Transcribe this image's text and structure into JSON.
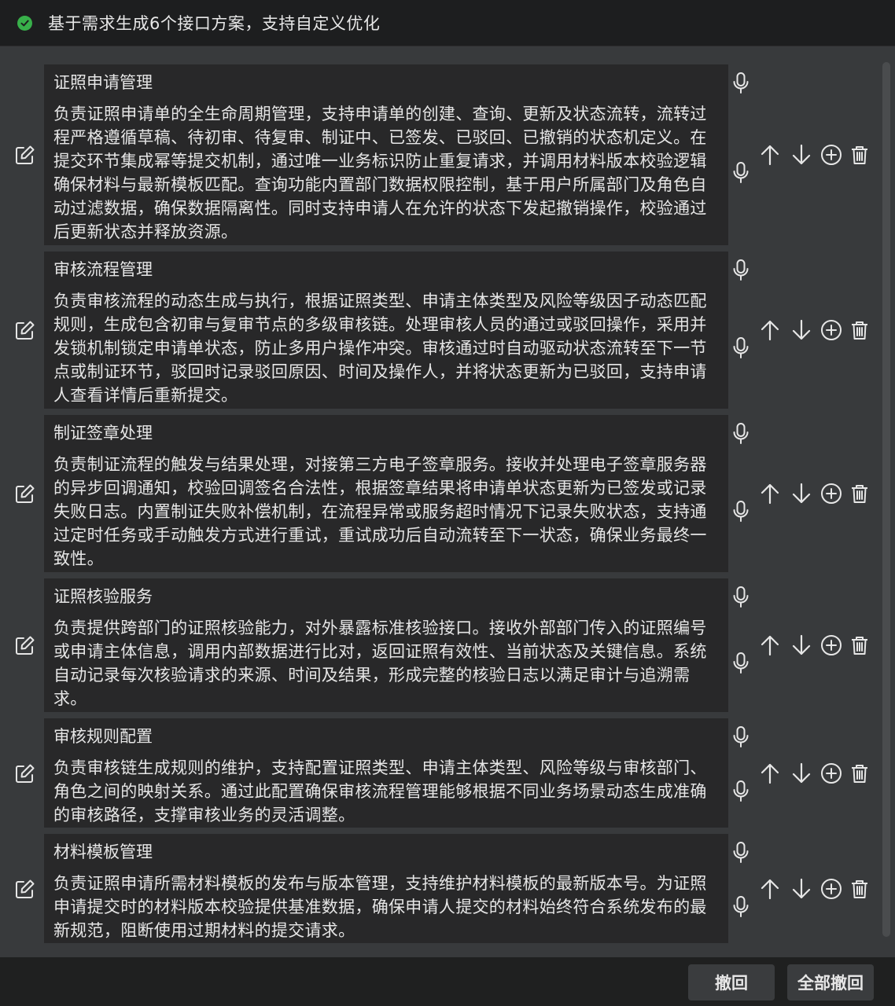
{
  "header": {
    "title": "基于需求生成6个接口方案，支持自定义优化"
  },
  "items": [
    {
      "title": "证照申请管理",
      "desc": "负责证照申请单的全生命周期管理，支持申请单的创建、查询、更新及状态流转，流转过程严格遵循草稿、待初审、待复审、制证中、已签发、已驳回、已撤销的状态机定义。在提交环节集成幂等提交机制，通过唯一业务标识防止重复请求，并调用材料版本校验逻辑确保材料与最新模板匹配。查询功能内置部门数据权限控制，基于用户所属部门及角色自动过滤数据，确保数据隔离性。同时支持申请人在允许的状态下发起撤销操作，校验通过后更新状态并释放资源。"
    },
    {
      "title": "审核流程管理",
      "desc": "负责审核流程的动态生成与执行，根据证照类型、申请主体类型及风险等级因子动态匹配规则，生成包含初审与复审节点的多级审核链。处理审核人员的通过或驳回操作，采用并发锁机制锁定申请单状态，防止多用户操作冲突。审核通过时自动驱动状态流转至下一节点或制证环节，驳回时记录驳回原因、时间及操作人，并将状态更新为已驳回，支持申请人查看详情后重新提交。"
    },
    {
      "title": "制证签章处理",
      "desc": "负责制证流程的触发与结果处理，对接第三方电子签章服务。接收并处理电子签章服务器的异步回调通知，校验回调签名合法性，根据签章结果将申请单状态更新为已签发或记录失败日志。内置制证失败补偿机制，在流程异常或服务超时情况下记录失败状态，支持通过定时任务或手动触发方式进行重试，重试成功后自动流转至下一状态，确保业务最终一致性。"
    },
    {
      "title": "证照核验服务",
      "desc": "负责提供跨部门的证照核验能力，对外暴露标准核验接口。接收外部部门传入的证照编号或申请主体信息，调用内部数据进行比对，返回证照有效性、当前状态及关键信息。系统自动记录每次核验请求的来源、时间及结果，形成完整的核验日志以满足审计与追溯需求。"
    },
    {
      "title": "审核规则配置",
      "desc": "负责审核链生成规则的维护，支持配置证照类型、申请主体类型、风险等级与审核部门、角色之间的映射关系。通过此配置确保审核流程管理能够根据不同业务场景动态生成准确的审核路径，支撑审核业务的灵活调整。"
    },
    {
      "title": "材料模板管理",
      "desc": "负责证照申请所需材料模板的发布与版本管理，支持维护材料模板的最新版本号。为证照申请提交时的材料版本校验提供基准数据，确保申请人提交的材料始终符合系统发布的最新规范，阻断使用过期材料的提交请求。"
    }
  ],
  "footer": {
    "undo_label": "撤回",
    "undo_all_label": "全部撤回"
  },
  "colors": {
    "accent_check": "#38b04a",
    "card_bg": "#282829",
    "panel_bg": "#383a3c"
  }
}
